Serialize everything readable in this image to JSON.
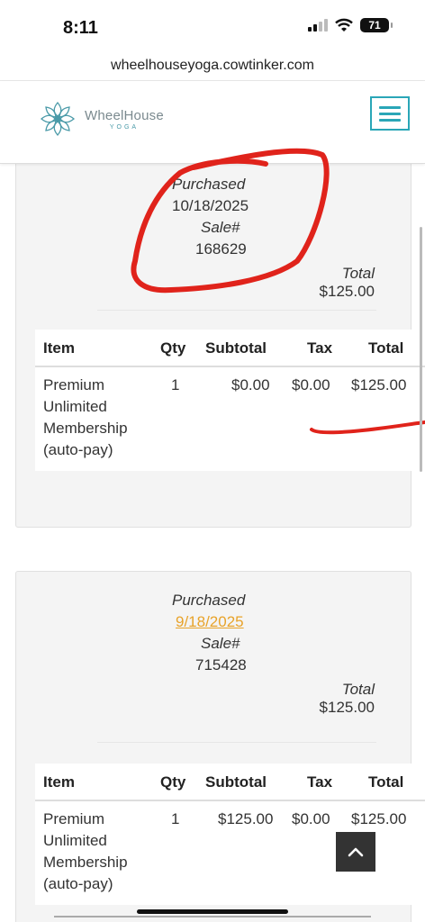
{
  "status_bar": {
    "time": "8:11",
    "battery": "71"
  },
  "browser": {
    "url": "wheelhouseyoga.cowtinker.com"
  },
  "header": {
    "logo_name": "WheelHouse",
    "logo_sub": "YOGA"
  },
  "table_headers": {
    "item": "Item",
    "qty": "Qty",
    "subtotal": "Subtotal",
    "tax": "Tax",
    "total": "Total"
  },
  "labels": {
    "purchased": "Purchased",
    "sale": "Sale#",
    "total": "Total"
  },
  "sales": [
    {
      "purchased_date": "10/18/2025",
      "sale_number": "168629",
      "total": "$125.00",
      "items": [
        {
          "name": "Premium Unlimited Membership (auto-pay)",
          "qty": "1",
          "subtotal": "$0.00",
          "tax": "$0.00",
          "total": "$125.00"
        }
      ]
    },
    {
      "purchased_date": "9/18/2025",
      "sale_number": "715428",
      "total": "$125.00",
      "items": [
        {
          "name": "Premium Unlimited Membership (auto-pay)",
          "qty": "1",
          "subtotal": "$125.00",
          "tax": "$0.00",
          "total": "$125.00"
        }
      ]
    }
  ],
  "colors": {
    "accent": "#2aa6b7",
    "link": "#e8a32a",
    "annotation": "#e0231b"
  }
}
